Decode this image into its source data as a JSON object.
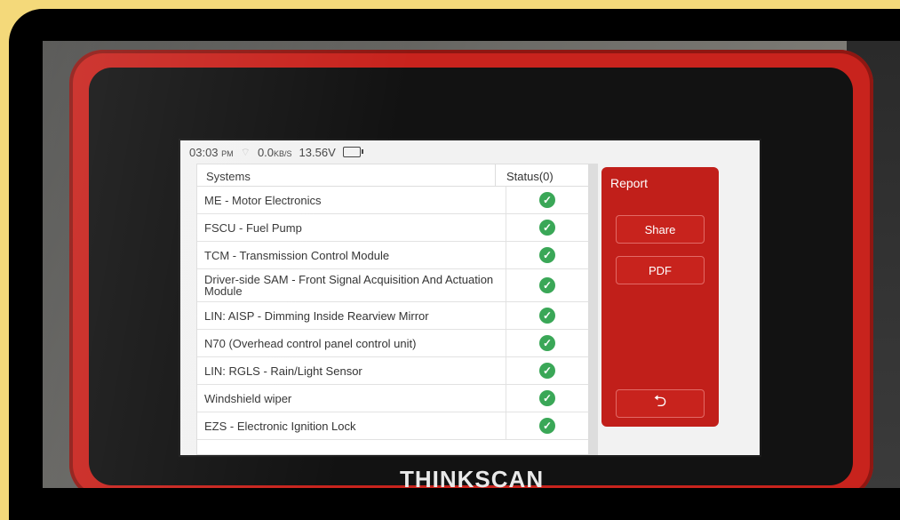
{
  "statusbar": {
    "time": "03:03",
    "ampm": "PM",
    "speed": "0.0",
    "speed_unit": "KB/S",
    "voltage": "13.56V"
  },
  "table": {
    "col_systems": "Systems",
    "col_status": "Status(0)",
    "rows": [
      {
        "name": "ME - Motor Electronics"
      },
      {
        "name": "FSCU - Fuel Pump"
      },
      {
        "name": "TCM - Transmission Control Module"
      },
      {
        "name": "Driver-side SAM - Front Signal Acquisition And Actuation Module"
      },
      {
        "name": "LIN: AISP - Dimming Inside Rearview Mirror"
      },
      {
        "name": "N70 (Overhead control panel control unit)"
      },
      {
        "name": "LIN: RGLS - Rain/Light Sensor"
      },
      {
        "name": "Windshield wiper"
      },
      {
        "name": "EZS - Electronic Ignition Lock"
      }
    ]
  },
  "panel": {
    "title": "Report",
    "share": "Share",
    "pdf": "PDF",
    "back_icon": "back-arrow-icon"
  },
  "brand": "THINKSCAN",
  "colors": {
    "accent": "#c11f1a",
    "ok": "#3aa757",
    "frame": "#f4d97a"
  }
}
